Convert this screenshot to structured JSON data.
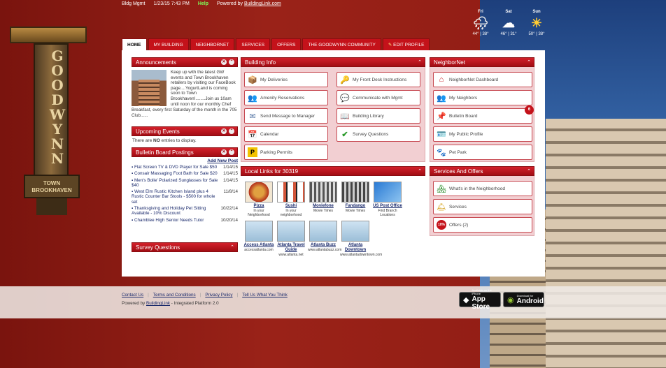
{
  "topbar": {
    "user": "Bldg Mgmt",
    "datetime": "1/23/15 7:43 PM",
    "help": "Help",
    "powered_prefix": "Powered by",
    "powered_link": "BuildingLink.com"
  },
  "weather": [
    {
      "day": "Fri",
      "icon": "rain-cloud-icon",
      "glyph": "🌧",
      "high": "44°",
      "low": "38°"
    },
    {
      "day": "Sat",
      "icon": "cloud-icon",
      "glyph": "☁",
      "high": "46°",
      "low": "31°"
    },
    {
      "day": "Sun",
      "icon": "sun-icon",
      "glyph": "☀",
      "high": "50°",
      "low": "38°"
    }
  ],
  "nav": {
    "tabs": [
      "HOME",
      "MY BUILDING",
      "NEIGHBORNET",
      "SERVICES",
      "OFFERS",
      "THE GOODWYNN COMMUNITY",
      "EDIT PROFILE"
    ]
  },
  "sign": {
    "name": "GOODWYNN",
    "sub1": "TOWN",
    "sub2": "BROOKHAVEN"
  },
  "announcements": {
    "title": "Announcements",
    "text1": "Keep up with the latest GW events and Town Brookhaven retailers by visiting our FaceBook page....YogurtLand is coming soon to Town Brookhaven!........Join us 10am until noon for our monthly Chef",
    "text2": "Breakfast, every first Saturday of the month in the 705 Club......"
  },
  "upcoming": {
    "title": "Upcoming Events",
    "pre": "There are ",
    "bold": "NO",
    "post": " entries to display."
  },
  "bulletin": {
    "title": "Bulletin Board Postings",
    "add": "Add New Post",
    "posts": [
      {
        "t": "Flat Screen TV & DVD Player for Sale $50",
        "d": "1/14/15"
      },
      {
        "t": "Consair Massaging Foot Bath for Sale $20",
        "d": "1/14/15"
      },
      {
        "t": "Men's Bolle' Polarized Sunglasses for Sale $40",
        "d": "1/14/15"
      },
      {
        "t": "West Elm Rustic Kitchen Island plus 4 Rustic Counter Bar Stools - $500 for whole set",
        "d": "11/8/14"
      },
      {
        "t": "Thanksgiving and Holiday Pet Sitting Available - 10% Discount",
        "d": "10/22/14"
      },
      {
        "t": "Chamblee High Senior Needs Tutor",
        "d": "10/20/14"
      }
    ]
  },
  "survey": {
    "title": "Survey Questions"
  },
  "building_info": {
    "title": "Building Info",
    "left": [
      "My Deliveries",
      "Amenity Reservations",
      "Send Message to Manager",
      "Calendar",
      "Parking Permits"
    ],
    "right": [
      "My Front Desk Instructions",
      "Communicate with Mgmt",
      "Building Library",
      "Survey Questions"
    ]
  },
  "local_links": {
    "title": "Local Links for 30319",
    "tiles": [
      {
        "name": "Pizza",
        "sub": "In your Neighborhood"
      },
      {
        "name": "Sushi",
        "sub": "In your neighborhood"
      },
      {
        "name": "Moviefone",
        "sub": "Movie Times"
      },
      {
        "name": "Fandango",
        "sub": "Movie Times"
      },
      {
        "name": "US Post Office",
        "sub": "Find Branch Locations"
      },
      {
        "name": "Access Atlanta",
        "sub": "accessatlanta.com"
      },
      {
        "name": "Atlanta Travel Guide",
        "sub": "www.atlanta.net"
      },
      {
        "name": "Atlanta Buzz",
        "sub": "www.atlantabuzz.com"
      },
      {
        "name": "Atlanta Downtown",
        "sub": "www.atlantadowntown.com"
      }
    ]
  },
  "neighbornet": {
    "title": "NeighborNet",
    "items": [
      "NeighborNet Dashboard",
      "My Neighbors",
      "Bulletin Board",
      "My Public Profile",
      "Pet Park"
    ],
    "badge": "6"
  },
  "services": {
    "title": "Services And Offers",
    "items": [
      "What's in the Neighborhood",
      "Services",
      "Offers (2)"
    ]
  },
  "footer": {
    "links": [
      "Contact Us",
      "Terms and Conditions",
      "Privacy Policy",
      "Tell Us What You Think"
    ],
    "powered_prefix": "Powered by ",
    "powered_link": "BuildingLink",
    "powered_suffix": " - Integrated Platform 2.0"
  },
  "stores": {
    "apple_small": "Available on the iPhone",
    "apple_big": "App Store",
    "android_small": "Download for",
    "android_big": "Android"
  }
}
